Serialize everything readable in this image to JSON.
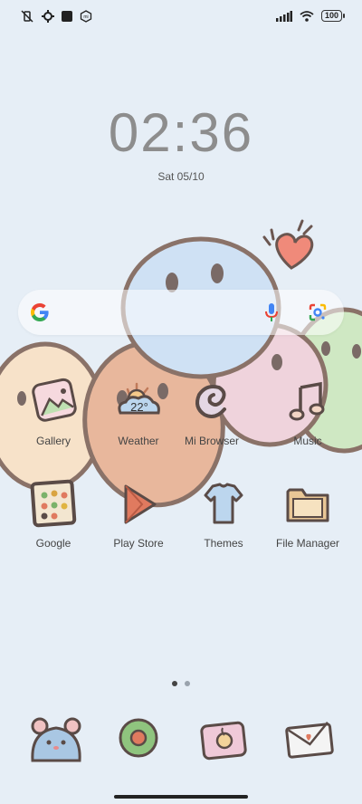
{
  "status": {
    "battery": "100",
    "left_icons": [
      "mute-vibrate-icon",
      "settings-icon",
      "square-app-icon",
      "mi-icon"
    ],
    "right_icons": [
      "signal-icon",
      "wifi-icon",
      "battery-icon"
    ]
  },
  "clock": {
    "time": "02:36",
    "date": "Sat 05/10"
  },
  "search": {
    "logo": "google-g-icon",
    "voice": "microphone-icon",
    "lens": "google-lens-icon"
  },
  "apps": [
    {
      "label": "Gallery",
      "icon": "gallery-icon"
    },
    {
      "label": "Weather",
      "icon": "weather-icon",
      "temp": "22°"
    },
    {
      "label": "Mi Browser",
      "icon": "browser-icon"
    },
    {
      "label": "Music",
      "icon": "music-icon"
    },
    {
      "label": "Google",
      "icon": "google-folder-icon"
    },
    {
      "label": "Play Store",
      "icon": "play-store-icon"
    },
    {
      "label": "Themes",
      "icon": "themes-icon"
    },
    {
      "label": "File Manager",
      "icon": "file-manager-icon"
    }
  ],
  "dock": [
    {
      "icon": "phone-mouse-icon"
    },
    {
      "icon": "messages-icon"
    },
    {
      "icon": "camera-icon"
    },
    {
      "icon": "mail-icon"
    }
  ],
  "pages": {
    "count": 2,
    "active": 1
  },
  "colors": {
    "background": "#e6eef6",
    "blob_peach": "#f7e2c9",
    "blob_orange": "#e8b79c",
    "blob_blue": "#cbe0f5",
    "blob_pink": "#efd3dc",
    "blob_green": "#cfe8c3",
    "outline": "#8a7268",
    "heart": "#f08a7a"
  }
}
